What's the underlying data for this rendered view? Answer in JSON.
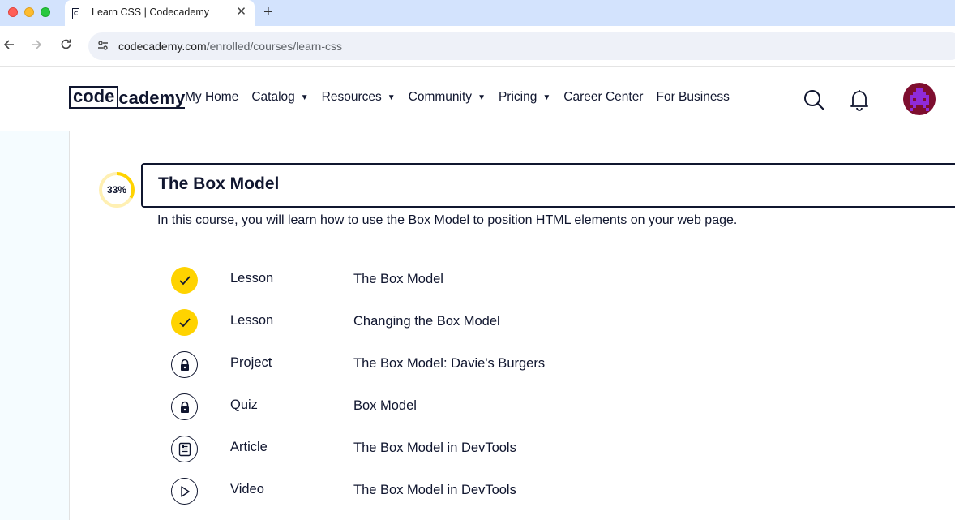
{
  "browser": {
    "tab_title": "Learn CSS | Codecademy",
    "tab_close": "✕",
    "new_tab": "+",
    "url_domain": "codecademy.com",
    "url_path": "/enrolled/courses/learn-css"
  },
  "header": {
    "logo_code": "code",
    "logo_cademy": "cademy",
    "nav": [
      {
        "label": "My Home",
        "dropdown": false
      },
      {
        "label": "Catalog",
        "dropdown": true
      },
      {
        "label": "Resources",
        "dropdown": true
      },
      {
        "label": "Community",
        "dropdown": true
      },
      {
        "label": "Pricing",
        "dropdown": true
      },
      {
        "label": "Career Center",
        "dropdown": false
      },
      {
        "label": "For Business",
        "dropdown": false
      }
    ],
    "caret": "▼"
  },
  "module": {
    "progress_percent": 33,
    "progress_label": "33%",
    "title": "The Box Model",
    "description": "In this course, you will learn how to use the Box Model to position HTML elements on your web page."
  },
  "items": [
    {
      "status": "done",
      "icon": "check-icon",
      "type": "Lesson",
      "name": "The Box Model"
    },
    {
      "status": "done",
      "icon": "check-icon",
      "type": "Lesson",
      "name": "Changing the Box Model"
    },
    {
      "status": "locked",
      "icon": "lock-icon",
      "type": "Project",
      "name": "The Box Model: Davie's Burgers"
    },
    {
      "status": "locked",
      "icon": "lock-icon",
      "type": "Quiz",
      "name": "Box Model"
    },
    {
      "status": "open",
      "icon": "article-icon",
      "type": "Article",
      "name": "The Box Model in DevTools"
    },
    {
      "status": "open",
      "icon": "play-icon",
      "type": "Video",
      "name": "The Box Model in DevTools"
    }
  ],
  "colors": {
    "accent_yellow": "#ffd300",
    "navy": "#10162f",
    "progress_track": "#fff0b3",
    "avatar_bg": "#7e0e2f",
    "avatar_fg": "#8f2bd9"
  }
}
